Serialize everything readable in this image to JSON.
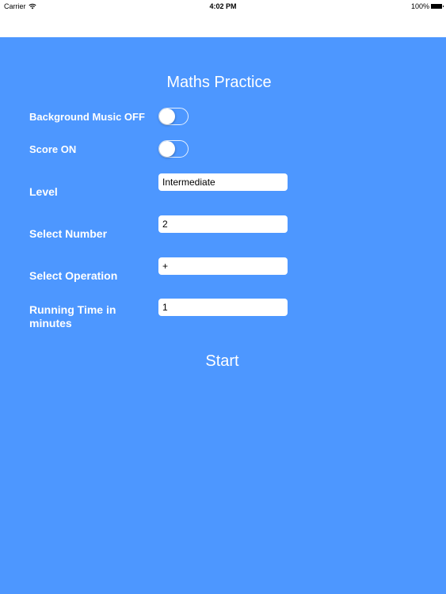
{
  "status_bar": {
    "carrier": "Carrier",
    "time": "4:02 PM",
    "battery": "100%"
  },
  "screen": {
    "title": "Maths Practice",
    "background_color": "#4d97ff",
    "settings": [
      {
        "label": "Background Music OFF",
        "type": "toggle",
        "on": false
      },
      {
        "label": "Score ON",
        "type": "toggle",
        "on": false
      }
    ],
    "fields": [
      {
        "label": "Level",
        "value": "Intermediate"
      },
      {
        "label": "Select Number",
        "value": "2"
      },
      {
        "label": "Select Operation",
        "value": "+"
      },
      {
        "label": "Running Time in minutes",
        "value": "1"
      }
    ],
    "start_label": "Start"
  }
}
